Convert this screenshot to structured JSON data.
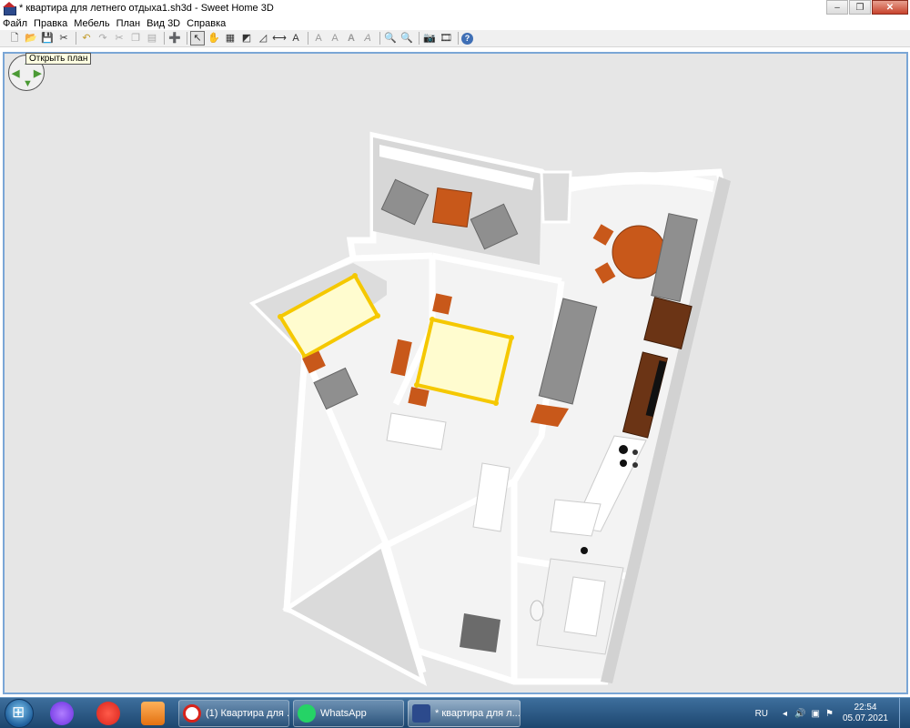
{
  "window": {
    "title": "* квартира для летнего отдыха1.sh3d - Sweet Home 3D",
    "minimize": "–",
    "restore": "❐",
    "close": "✕"
  },
  "menu": {
    "items": [
      {
        "label": "Файл"
      },
      {
        "label": "Правка"
      },
      {
        "label": "Мебель"
      },
      {
        "label": "План"
      },
      {
        "label": "Вид 3D"
      },
      {
        "label": "Справка"
      }
    ]
  },
  "toolbar": {
    "buttons": [
      {
        "name": "new-home",
        "glyph": "🗋"
      },
      {
        "name": "open",
        "glyph": "📂"
      },
      {
        "name": "save",
        "glyph": "💾"
      },
      {
        "name": "preferences",
        "glyph": "✂"
      },
      {
        "name": "undo",
        "glyph": "↶"
      },
      {
        "name": "redo",
        "glyph": "↷"
      },
      {
        "name": "cut",
        "glyph": "✂"
      },
      {
        "name": "copy",
        "glyph": "❐"
      },
      {
        "name": "paste",
        "glyph": "▤"
      },
      {
        "name": "add-furniture",
        "glyph": "➕"
      },
      {
        "name": "select-mode",
        "glyph": "↖"
      },
      {
        "name": "pan-mode",
        "glyph": "✋"
      },
      {
        "name": "create-walls",
        "glyph": "▦"
      },
      {
        "name": "create-rooms",
        "glyph": "◩"
      },
      {
        "name": "create-polylines",
        "glyph": "◿"
      },
      {
        "name": "create-dimensions",
        "glyph": "⟷"
      },
      {
        "name": "create-labels",
        "glyph": "A"
      },
      {
        "name": "increase-text",
        "glyph": "A"
      },
      {
        "name": "decrease-text",
        "glyph": "A"
      },
      {
        "name": "bold-text",
        "glyph": "A"
      },
      {
        "name": "italic-text",
        "glyph": "A"
      },
      {
        "name": "zoom-in",
        "glyph": "🔍"
      },
      {
        "name": "zoom-out",
        "glyph": "🔍"
      },
      {
        "name": "create-photo",
        "glyph": "📷"
      },
      {
        "name": "create-video",
        "glyph": "🎞"
      },
      {
        "name": "help",
        "glyph": "?"
      }
    ]
  },
  "view3d": {
    "tooltip": "Открыть план"
  },
  "taskbar": {
    "tasks": [
      {
        "label": "(1) Квартира для ..."
      },
      {
        "label": "WhatsApp"
      },
      {
        "label": "* квартира для л..."
      }
    ],
    "language": "RU",
    "time": "22:54",
    "date": "05.07.2021"
  },
  "colors": {
    "accent": "#7aa6d6",
    "floor_selected": "#fffccf",
    "bed_outline": "#f5c800",
    "furniture_wood": "#c8581a",
    "sofa": "#8f8f8f"
  }
}
